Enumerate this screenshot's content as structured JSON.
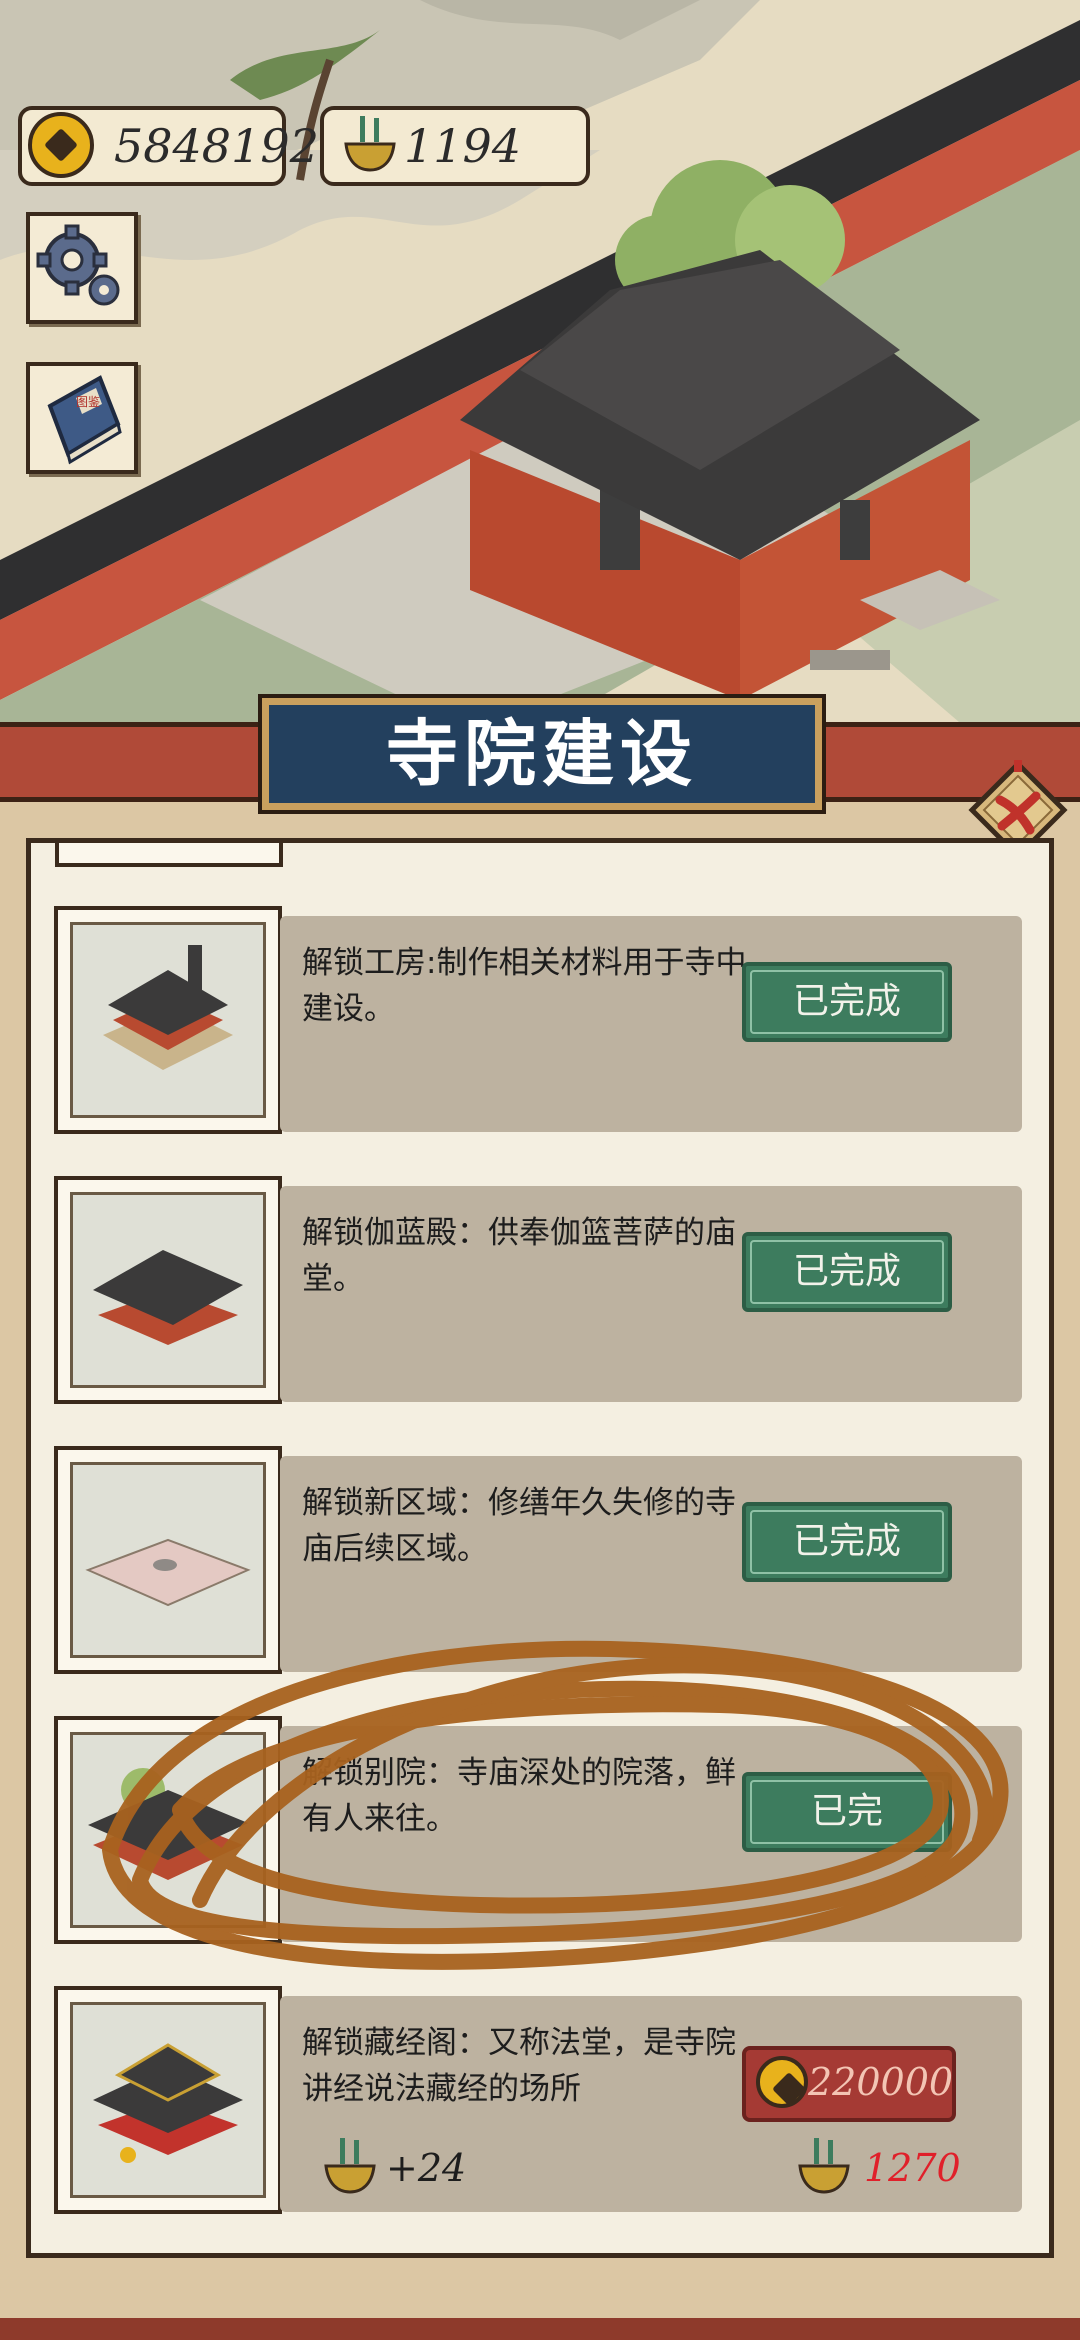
{
  "currencies": {
    "coins": "5848192",
    "incense": "1194"
  },
  "icons": {
    "settings": "gear-icon",
    "handbook": "book-icon",
    "close": "close-icon",
    "coin": "coin-icon",
    "incense": "incense-burner-icon"
  },
  "handbook_label": "图鉴",
  "banner": {
    "title": "寺院建设"
  },
  "tasks": [
    {
      "desc": "解锁工房:制作相关材料用于寺中建设。",
      "status": "已完成"
    },
    {
      "desc": "解锁伽蓝殿：供奉伽篮菩萨的庙堂。",
      "status": "已完成"
    },
    {
      "desc": "解锁新区域：修缮年久失修的寺庙后续区域。",
      "status": "已完成"
    },
    {
      "desc": "解锁别院：寺庙深处的院落，鲜有人来往。",
      "status": "已完"
    },
    {
      "desc": "解锁藏经阁：又称法堂，是寺院讲经说法藏经的场所",
      "cost": "220000",
      "reward": "+24",
      "incense_required": "1270"
    }
  ],
  "colors": {
    "done_button": "#3d7c5e",
    "cost_button": "#a53a34",
    "banner": "#23405e",
    "ribbon": "#b04a38",
    "scribble": "#a8621f",
    "required_text": "#e0202a"
  }
}
